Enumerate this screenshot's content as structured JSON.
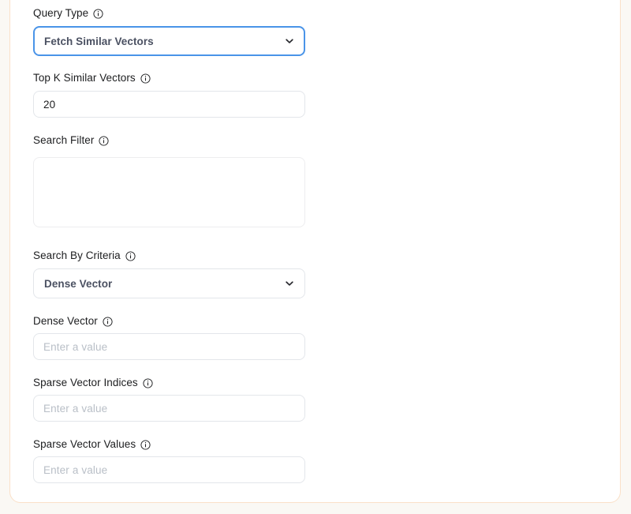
{
  "panel": {
    "border_color": "#fae0c8",
    "background": "#ffffff",
    "page_background": "#faf8f4"
  },
  "theme": {
    "focus_border": "#4a94e8",
    "input_border": "#e3e6ea",
    "textarea_border": "#ededef",
    "label_text": "#1c1d1f",
    "value_text": "#1c1d1f",
    "select_value_text": "#4b5162",
    "placeholder_text": "#b9bfc7"
  },
  "form": {
    "fields": [
      {
        "id": "query-type",
        "label": "Query Type",
        "info_icon": "info-circle-icon",
        "type": "select",
        "value": "Fetch Similar Vectors",
        "focused": true,
        "chevron_icon": "chevron-down-icon"
      },
      {
        "id": "top-k-similar-vectors",
        "label": "Top K Similar Vectors",
        "info_icon": "info-circle-icon",
        "type": "text",
        "value": "20",
        "placeholder": ""
      },
      {
        "id": "search-filter",
        "label": "Search Filter",
        "info_icon": "info-circle-icon",
        "type": "textarea",
        "value": "",
        "placeholder": ""
      },
      {
        "id": "search-by-criteria",
        "label": "Search By Criteria",
        "info_icon": "info-circle-icon",
        "type": "select",
        "value": "Dense Vector",
        "focused": false,
        "chevron_icon": "chevron-down-icon"
      },
      {
        "id": "dense-vector",
        "label": "Dense Vector",
        "info_icon": "info-circle-icon",
        "type": "text",
        "value": "",
        "placeholder": "Enter a value"
      },
      {
        "id": "sparse-vector-indices",
        "label": "Sparse Vector Indices",
        "info_icon": "info-circle-icon",
        "type": "text",
        "value": "",
        "placeholder": "Enter a value"
      },
      {
        "id": "sparse-vector-values",
        "label": "Sparse Vector Values",
        "info_icon": "info-circle-icon",
        "type": "text",
        "value": "",
        "placeholder": "Enter a value"
      }
    ]
  }
}
